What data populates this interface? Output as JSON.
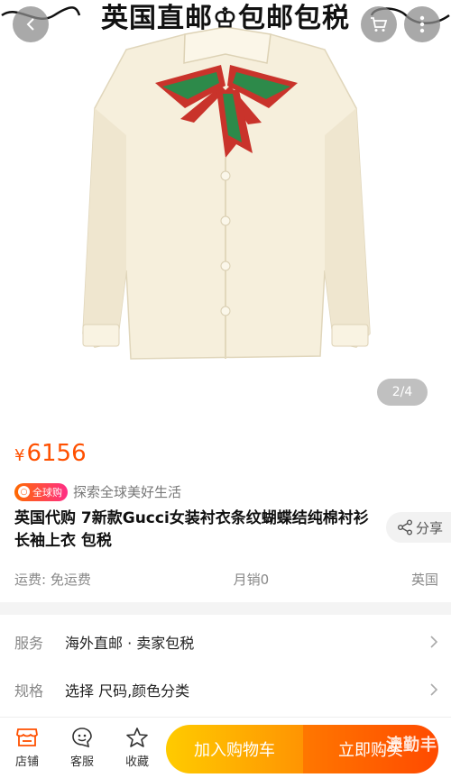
{
  "banner": {
    "text": "英国直邮♔包邮包税"
  },
  "image": {
    "pager": "2/4"
  },
  "product": {
    "currency": "¥",
    "price": "6156",
    "slogan_badge": "全球购",
    "slogan": "探索全球美好生活",
    "title": "英国代购 7新款Gucci女装衬衣条纹蝴蝶结纯棉衬衫长袖上衣 包税",
    "share": "分享",
    "shipping": "运费: 免运费",
    "monthly_sales": "月销0",
    "origin": "英国"
  },
  "specs": [
    {
      "key": "服务",
      "value": "海外直邮 · 卖家包税"
    },
    {
      "key": "规格",
      "value": "选择 尺码,颜色分类"
    }
  ],
  "bottom_bar": {
    "shop": "店铺",
    "service": "客服",
    "favorite": "收藏",
    "add_to_cart": "加入购物车",
    "buy_now": "立即购买"
  },
  "watermark": "澳勤丰",
  "colors": {
    "accent": "#ff5000",
    "cart": "#ffb400",
    "buy": "#ff5a00"
  }
}
